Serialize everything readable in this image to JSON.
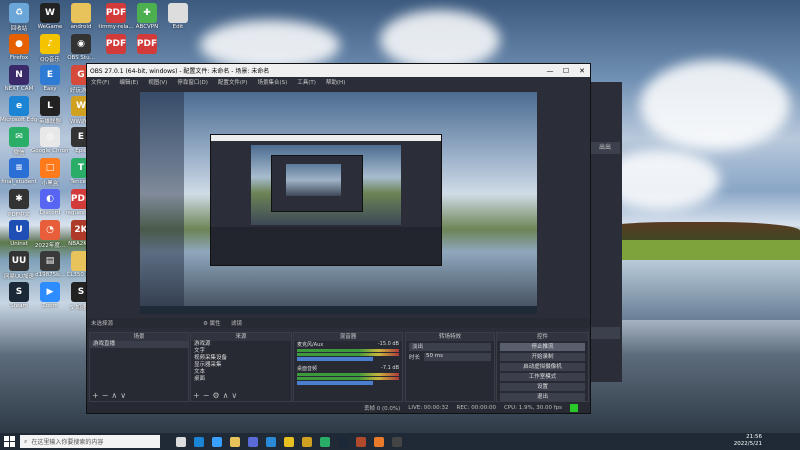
{
  "desktop": {
    "icons": [
      {
        "label": "回收站",
        "col": 0,
        "row": 0,
        "color": "#6aa6d8",
        "glyph": "♻"
      },
      {
        "label": "WeGame",
        "col": 1,
        "row": 0,
        "color": "#222222",
        "glyph": "W"
      },
      {
        "label": "android",
        "col": 2,
        "row": 0,
        "color": "#e8c25a",
        "glyph": ""
      },
      {
        "label": "timmy-rela...",
        "col": 3,
        "row": 0,
        "color": "#d33b3b",
        "glyph": "PDF"
      },
      {
        "label": "ABCVPN",
        "col": 4,
        "row": 0,
        "color": "#4caf50",
        "glyph": "✚"
      },
      {
        "label": "Edit",
        "col": 5,
        "row": 0,
        "color": "#dddddd",
        "glyph": ""
      },
      {
        "label": "Firefox",
        "col": 0,
        "row": 1,
        "color": "#e66000",
        "glyph": "●"
      },
      {
        "label": "QQ音乐",
        "col": 1,
        "row": 1,
        "color": "#f5c400",
        "glyph": "♪"
      },
      {
        "label": "OBS Stu...",
        "col": 2,
        "row": 1,
        "color": "#333333",
        "glyph": "◉"
      },
      {
        "label": "",
        "col": 3,
        "row": 1,
        "color": "#d33b3b",
        "glyph": "PDF"
      },
      {
        "label": "",
        "col": 4,
        "row": 1,
        "color": "#d33b3b",
        "glyph": "PDF"
      },
      {
        "label": "NEXT CAM",
        "col": 0,
        "row": 2,
        "color": "#3a2a6a",
        "glyph": "N"
      },
      {
        "label": "Easy",
        "col": 1,
        "row": 2,
        "color": "#2e7bd6",
        "glyph": "E"
      },
      {
        "label": "好玩游戏",
        "col": 2,
        "row": 2,
        "color": "#d54a3a",
        "glyph": "G"
      },
      {
        "label": "Microsoft Edge",
        "col": 0,
        "row": 3,
        "color": "#1b84d4",
        "glyph": "e"
      },
      {
        "label": "英雄联盟",
        "col": 1,
        "row": 3,
        "color": "#222222",
        "glyph": "L"
      },
      {
        "label": "WW游戏",
        "col": 2,
        "row": 3,
        "color": "#d0a020",
        "glyph": "W"
      },
      {
        "label": "微信",
        "col": 0,
        "row": 4,
        "color": "#2aae67",
        "glyph": "✉"
      },
      {
        "label": "Google Chrome",
        "col": 1,
        "row": 4,
        "color": "#e8e8e8",
        "glyph": "◎"
      },
      {
        "label": "Epic",
        "col": 2,
        "row": 4,
        "color": "#333333",
        "glyph": "E"
      },
      {
        "label": "final_student",
        "col": 0,
        "row": 5,
        "color": "#2a6fd6",
        "glyph": "≡"
      },
      {
        "label": "小黑盒",
        "col": 1,
        "row": 5,
        "color": "#ff7a1a",
        "glyph": "□"
      },
      {
        "label": "Tencent",
        "col": 2,
        "row": 5,
        "color": "#2aae67",
        "glyph": "T"
      },
      {
        "label": "PDF中文",
        "col": 0,
        "row": 6,
        "color": "#333333",
        "glyph": "✱"
      },
      {
        "label": "Discord",
        "col": 1,
        "row": 6,
        "color": "#5865f2",
        "glyph": "◐"
      },
      {
        "label": "requestio...",
        "col": 2,
        "row": 6,
        "color": "#d33b3b",
        "glyph": "PDF"
      },
      {
        "label": "Uninst",
        "col": 0,
        "row": 7,
        "color": "#1f4fb4",
        "glyph": "U"
      },
      {
        "label": "2022年度...",
        "col": 1,
        "row": 7,
        "color": "#e85d3a",
        "glyph": "◔"
      },
      {
        "label": "NBA2K22",
        "col": 2,
        "row": 7,
        "color": "#b03a2a",
        "glyph": "2K"
      },
      {
        "label": "网易UU加速",
        "col": 0,
        "row": 8,
        "color": "#333333",
        "glyph": "UU"
      },
      {
        "label": "d19875b...",
        "col": 1,
        "row": 8,
        "color": "#3a3a3a",
        "glyph": "▤"
      },
      {
        "label": "CL350.exe",
        "col": 2,
        "row": 8,
        "color": "#e8c25a",
        "glyph": ""
      },
      {
        "label": "Steam",
        "col": 0,
        "row": 9,
        "color": "#1b2838",
        "glyph": "S"
      },
      {
        "label": "Zoom",
        "col": 1,
        "row": 9,
        "color": "#2d8cff",
        "glyph": "▶"
      },
      {
        "label": "S 加速器",
        "col": 2,
        "row": 9,
        "color": "#222222",
        "glyph": "S"
      }
    ]
  },
  "obs_back": {
    "buttons": [
      "出出",
      "",
      "",
      ""
    ]
  },
  "obs": {
    "title": "OBS 27.0.1 (64-bit, windows) - 配置文件: 未命名 - 场景: 未命名",
    "window_buttons": [
      "—",
      "☐",
      "✕"
    ],
    "menu": [
      "文件(F)",
      "编辑(E)",
      "视图(V)",
      "停靠窗口(D)",
      "配置文件(P)",
      "场景集合(S)",
      "工具(T)",
      "帮助(H)"
    ],
    "preview_label": "未选择源",
    "preview_props": "⚙ 属性",
    "preview_filters": "滤镜",
    "docks": {
      "scenes": {
        "title": "场景",
        "items": [
          "游戏直播"
        ]
      },
      "sources": {
        "title": "来源",
        "items": [
          "游戏源",
          "文字",
          "视频采集设备",
          "显示器采集",
          "文本",
          "桌面"
        ]
      },
      "mixer": {
        "title": "混音器",
        "channels": [
          {
            "name": "麦克风/Aux",
            "db": "-15.0 dB"
          },
          {
            "name": "桌面音频",
            "db": "-7.1 dB"
          }
        ]
      },
      "transitions": {
        "title": "转场特效",
        "type": "淡出",
        "duration_label": "时长",
        "duration": "50 ms"
      },
      "controls": {
        "title": "控件",
        "buttons": [
          "停止推流",
          "开始录制",
          "启动虚拟摄像机",
          "工作室模式",
          "设置",
          "退出"
        ]
      }
    },
    "status": [
      "丢帧 0 (0.0%)",
      "LIVE: 00:00:32",
      "REC: 00:00:00",
      "CPU: 1.9%, 30.00 fps"
    ]
  },
  "taskbar": {
    "search_placeholder": "在这里输入你要搜索的内容",
    "apps": [
      {
        "name": "task-view",
        "color": "#dddddd"
      },
      {
        "name": "edge",
        "color": "#1b84d4"
      },
      {
        "name": "windows",
        "color": "#3aa0ff"
      },
      {
        "name": "files",
        "color": "#e8c25a"
      },
      {
        "name": "store",
        "color": "#5a6ad8"
      },
      {
        "name": "vscode",
        "color": "#2a8ad8"
      },
      {
        "name": "chrome",
        "color": "#e8c020"
      },
      {
        "name": "game1",
        "color": "#d0a020"
      },
      {
        "name": "wechat",
        "color": "#2aae67"
      },
      {
        "name": "steam",
        "color": "#1b2838"
      },
      {
        "name": "game2",
        "color": "#b04a2a"
      },
      {
        "name": "game3",
        "color": "#e87a2a"
      },
      {
        "name": "obs",
        "color": "#444444"
      }
    ],
    "time": "21:56",
    "date": "2022/5/21"
  }
}
